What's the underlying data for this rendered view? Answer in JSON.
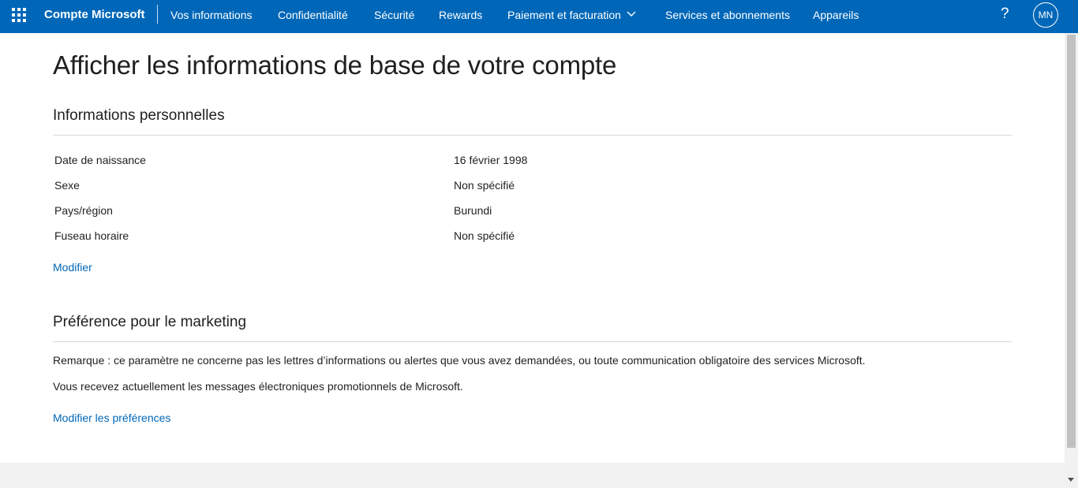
{
  "header": {
    "brand": "Compte Microsoft",
    "nav": [
      {
        "label": "Vos informations"
      },
      {
        "label": "Confidentialité"
      },
      {
        "label": "Sécurité"
      },
      {
        "label": "Rewards"
      },
      {
        "label": "Paiement et facturation"
      },
      {
        "label": "Services et abonnements"
      },
      {
        "label": "Appareils"
      }
    ],
    "help_label": "?",
    "avatar_initials": "MN",
    "icons": {
      "apps": "waffle-icon",
      "dropdown": "chevron-down-icon"
    },
    "accent_color": "#0067b8"
  },
  "main": {
    "title": "Afficher les informations de base de votre compte",
    "personal": {
      "heading": "Informations personnelles",
      "rows": [
        {
          "label": "Date de naissance",
          "value": "16 février 1998"
        },
        {
          "label": "Sexe",
          "value": "Non spécifié"
        },
        {
          "label": "Pays/région",
          "value": "Burundi"
        },
        {
          "label": "Fuseau horaire",
          "value": "Non spécifié"
        }
      ],
      "edit_link": "Modifier"
    },
    "marketing": {
      "heading": "Préférence pour le marketing",
      "note": "Remarque : ce paramètre ne concerne pas les lettres d’informations ou alertes que vous avez demandées, ou toute communication obligatoire des services Microsoft.",
      "status": "Vous recevez actuellement les messages électroniques promotionnels de Microsoft.",
      "edit_link": "Modifier les préférences"
    }
  }
}
